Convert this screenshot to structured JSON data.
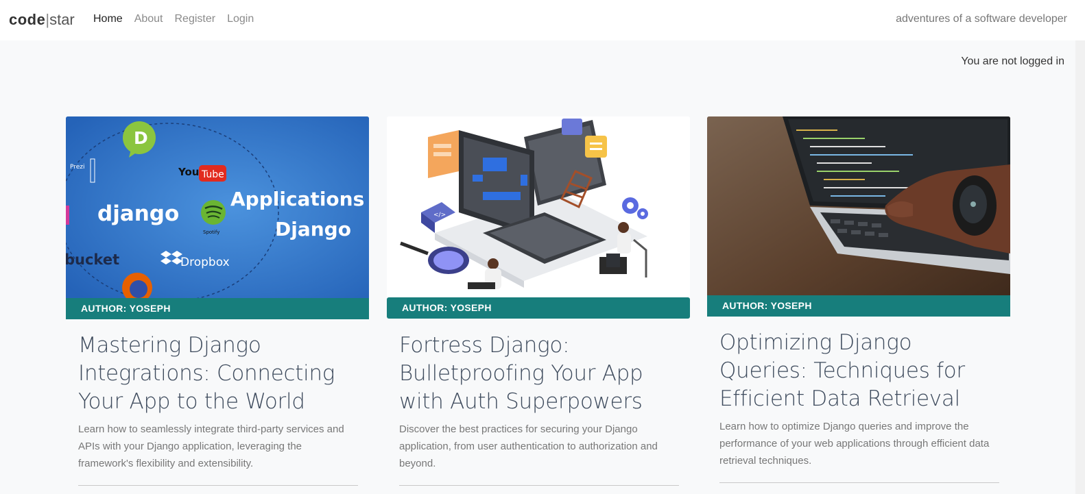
{
  "navbar": {
    "brand_bold": "code",
    "brand_sep": "|",
    "brand_light": "star",
    "tagline": "adventures of a software developer",
    "links": [
      {
        "label": "Home"
      },
      {
        "label": "About"
      },
      {
        "label": "Register"
      },
      {
        "label": "Login"
      }
    ]
  },
  "login_status": "You are not logged in",
  "posts": [
    {
      "author": "AUTHOR: YOSEPH",
      "title": "Mastering Django Integrations: Connecting Your App to the World",
      "excerpt": "Learn how to seamlessly integrate third-party services and APIs with your Django application, leveraging the framework's flexibility and extensibility.",
      "image_text": {
        "logo_letter": "D",
        "prezi": "Prezi",
        "you": "You",
        "tube": "Tube",
        "django": "django",
        "spotify": "Spotify",
        "applications": "Applications",
        "django_word": "Django",
        "bucket": "bucket",
        "dropbox": "Dropbox"
      }
    },
    {
      "author": "AUTHOR: YOSEPH",
      "title": "Fortress Django: Bulletproofing Your App with Auth Superpowers",
      "excerpt": "Discover the best practices for securing your Django application, from user authentication to authorization and beyond.",
      "image_text": {
        "code_tag": "</>"
      }
    },
    {
      "author": "AUTHOR: YOSEPH",
      "title": "Optimizing Django Queries: Techniques for Efficient Data Retrieval",
      "excerpt": "Learn how to optimize Django queries and improve the performance of your web applications through efficient data retrieval techniques."
    }
  ],
  "colors": {
    "author_bar": "#177e7c",
    "image1_bg": "#2f73c7",
    "title_text": "#3d4a5c"
  }
}
